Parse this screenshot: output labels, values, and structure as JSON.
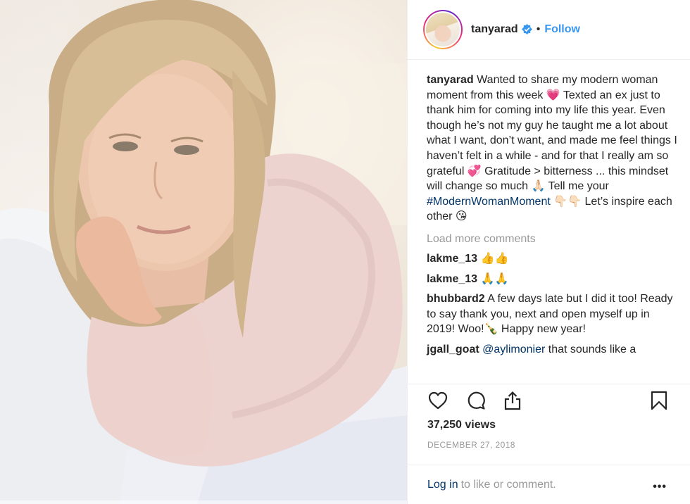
{
  "post": {
    "author": "tanyarad",
    "follow_label": "Follow",
    "separator": "•",
    "caption": {
      "user": "tanyarad",
      "text_before_hashtag": "Wanted to share my modern woman moment from this week 💗 Texted an ex just to thank him for coming into my life this year. Even though he’s not my guy he taught me a lot about what I want, don’t want, and made me feel things I haven’t felt in a while - and for that I really am so grateful 💞 Gratitude > bitterness ... this mindset will change so much 🙏🏻 Tell me your",
      "hashtag": "#ModernWomanMoment",
      "text_after_hashtag": "👇🏻👇🏻 Let’s inspire each other 😘"
    },
    "load_more": "Load more comments",
    "comments": [
      {
        "user": "lakme_13",
        "text": "👍👍"
      },
      {
        "user": "lakme_13",
        "text": "🙏🙏"
      },
      {
        "user": "bhubbard2",
        "text": "A few days late but I did it too! Ready to say thank you, next and open myself up in 2019! Woo!🍾 Happy new year!"
      },
      {
        "user": "jgall_goat",
        "mention": "@aylimonier",
        "text": "that sounds like a"
      }
    ],
    "views": "37,250 views",
    "date": "DECEMBER 27, 2018",
    "login_link": "Log in",
    "login_rest": "to like or comment.",
    "more_label": "•••"
  },
  "colors": {
    "link_blue": "#3897f0",
    "dark_link": "#003569",
    "muted": "#999999",
    "text": "#262626"
  },
  "icons": [
    "verified-badge-icon",
    "heart-icon",
    "comment-icon",
    "share-icon",
    "bookmark-icon",
    "more-options-icon"
  ]
}
